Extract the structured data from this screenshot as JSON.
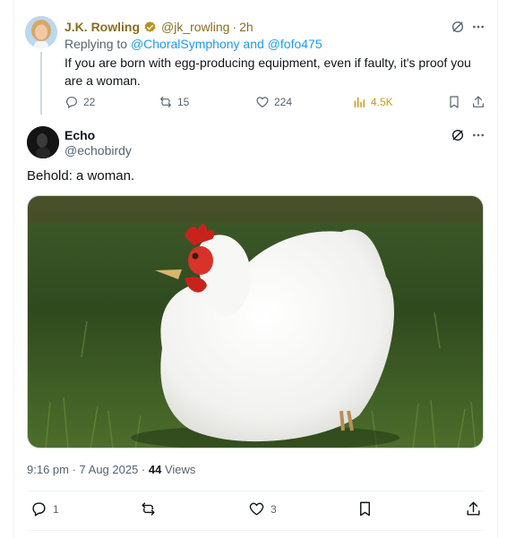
{
  "reply_tweet": {
    "author_name": "J.K. Rowling",
    "handle": "@jk_rowling",
    "separator": "·",
    "time": "2h",
    "replying_prefix": "Replying to ",
    "mention_1": "@ChoralSymphony",
    "and_text": " and ",
    "mention_2": "@fofo475",
    "text": "If you are born with egg-producing equipment, even if faulty, it's proof you are a woman.",
    "actions": {
      "replies": "22",
      "reposts": "15",
      "likes": "224",
      "views": "4.5K"
    },
    "icons": [
      "grok-icon",
      "more-icon",
      "reply-icon",
      "repost-icon",
      "like-icon",
      "views-icon",
      "bookmark-icon",
      "share-icon"
    ]
  },
  "main_tweet": {
    "author_name": "Echo",
    "handle": "@echobirdy",
    "text": "Behold: a woman.",
    "timestamp": "9:16 pm · 7 Aug 2025 · ",
    "views_count": "44",
    "views_label": " Views",
    "actions": {
      "replies": "1",
      "reposts": "",
      "likes": "3"
    }
  },
  "colors": {
    "accent": "#1d9bf0",
    "gold": "#8a6d1f",
    "muted": "#536471",
    "border": "#eff3f4"
  }
}
